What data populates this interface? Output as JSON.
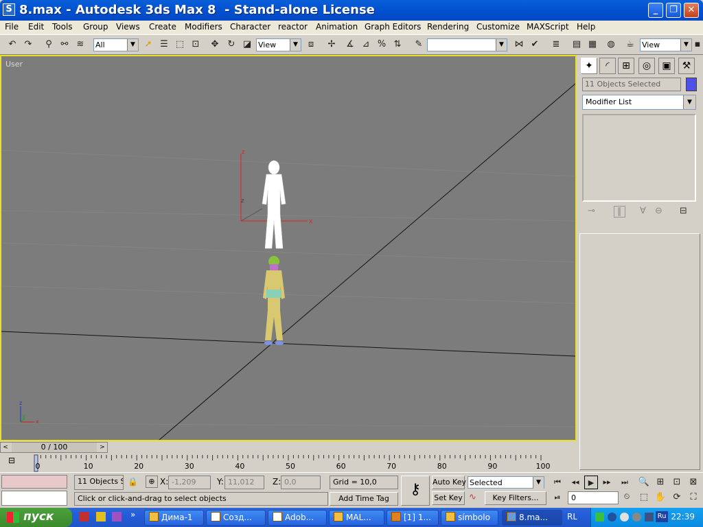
{
  "window": {
    "title": "8.max - Autodesk 3ds Max 8  - Stand-alone License",
    "icon": "3dsmax-icon",
    "min_label": "_",
    "max_label": "❐",
    "close_label": "✕"
  },
  "menu": [
    "File",
    "Edit",
    "Tools",
    "Group",
    "Views",
    "Create",
    "Modifiers",
    "Character",
    "reactor",
    "Animation",
    "Graph Editors",
    "Rendering",
    "Customize",
    "MAXScript",
    "Help"
  ],
  "toolbar": {
    "selection_filter": "All",
    "ref_coord": "View",
    "named_selection": "",
    "view_dropdown": "View"
  },
  "viewport": {
    "label": "User",
    "border_color": "#e8e020",
    "background": "#7c7c7c"
  },
  "command_panel": {
    "object_selection": "11 Objects Selected",
    "object_color": "#5050e8",
    "modifier_list": "Modifier List"
  },
  "time_slider": {
    "value": "0 / 100",
    "left_arrow": "<",
    "right_arrow": ">"
  },
  "trackbar": {
    "ticks": [
      "0",
      "10",
      "20",
      "30",
      "40",
      "50",
      "60",
      "70",
      "80",
      "90",
      "100"
    ]
  },
  "status": {
    "selection_count": "11 Objects Se",
    "x_label": "X:",
    "x_value": "-1,209",
    "y_label": "Y:",
    "y_value": "11,012",
    "z_label": "Z:",
    "z_value": "0,0",
    "grid": "Grid = 10,0",
    "prompt": "Click or click-and-drag to select objects",
    "add_time_tag": "Add Time Tag",
    "auto_key": "Auto Key",
    "set_key": "Set Key",
    "key_mode": "Selected",
    "key_filters": "Key Filters...",
    "frame": "0"
  },
  "taskbar": {
    "start": "пуск",
    "tasks": [
      {
        "label": "Дима-1",
        "active": false
      },
      {
        "label": "Созд...",
        "active": false
      },
      {
        "label": "Adob...",
        "active": false
      },
      {
        "label": "MAL...",
        "active": false
      },
      {
        "label": "[1] 1...",
        "active": false
      },
      {
        "label": "símbolo",
        "active": false
      },
      {
        "label": "8.ma...",
        "active": true
      }
    ],
    "lang": "RL",
    "tray_lang": "Ru",
    "clock": "22:39"
  }
}
